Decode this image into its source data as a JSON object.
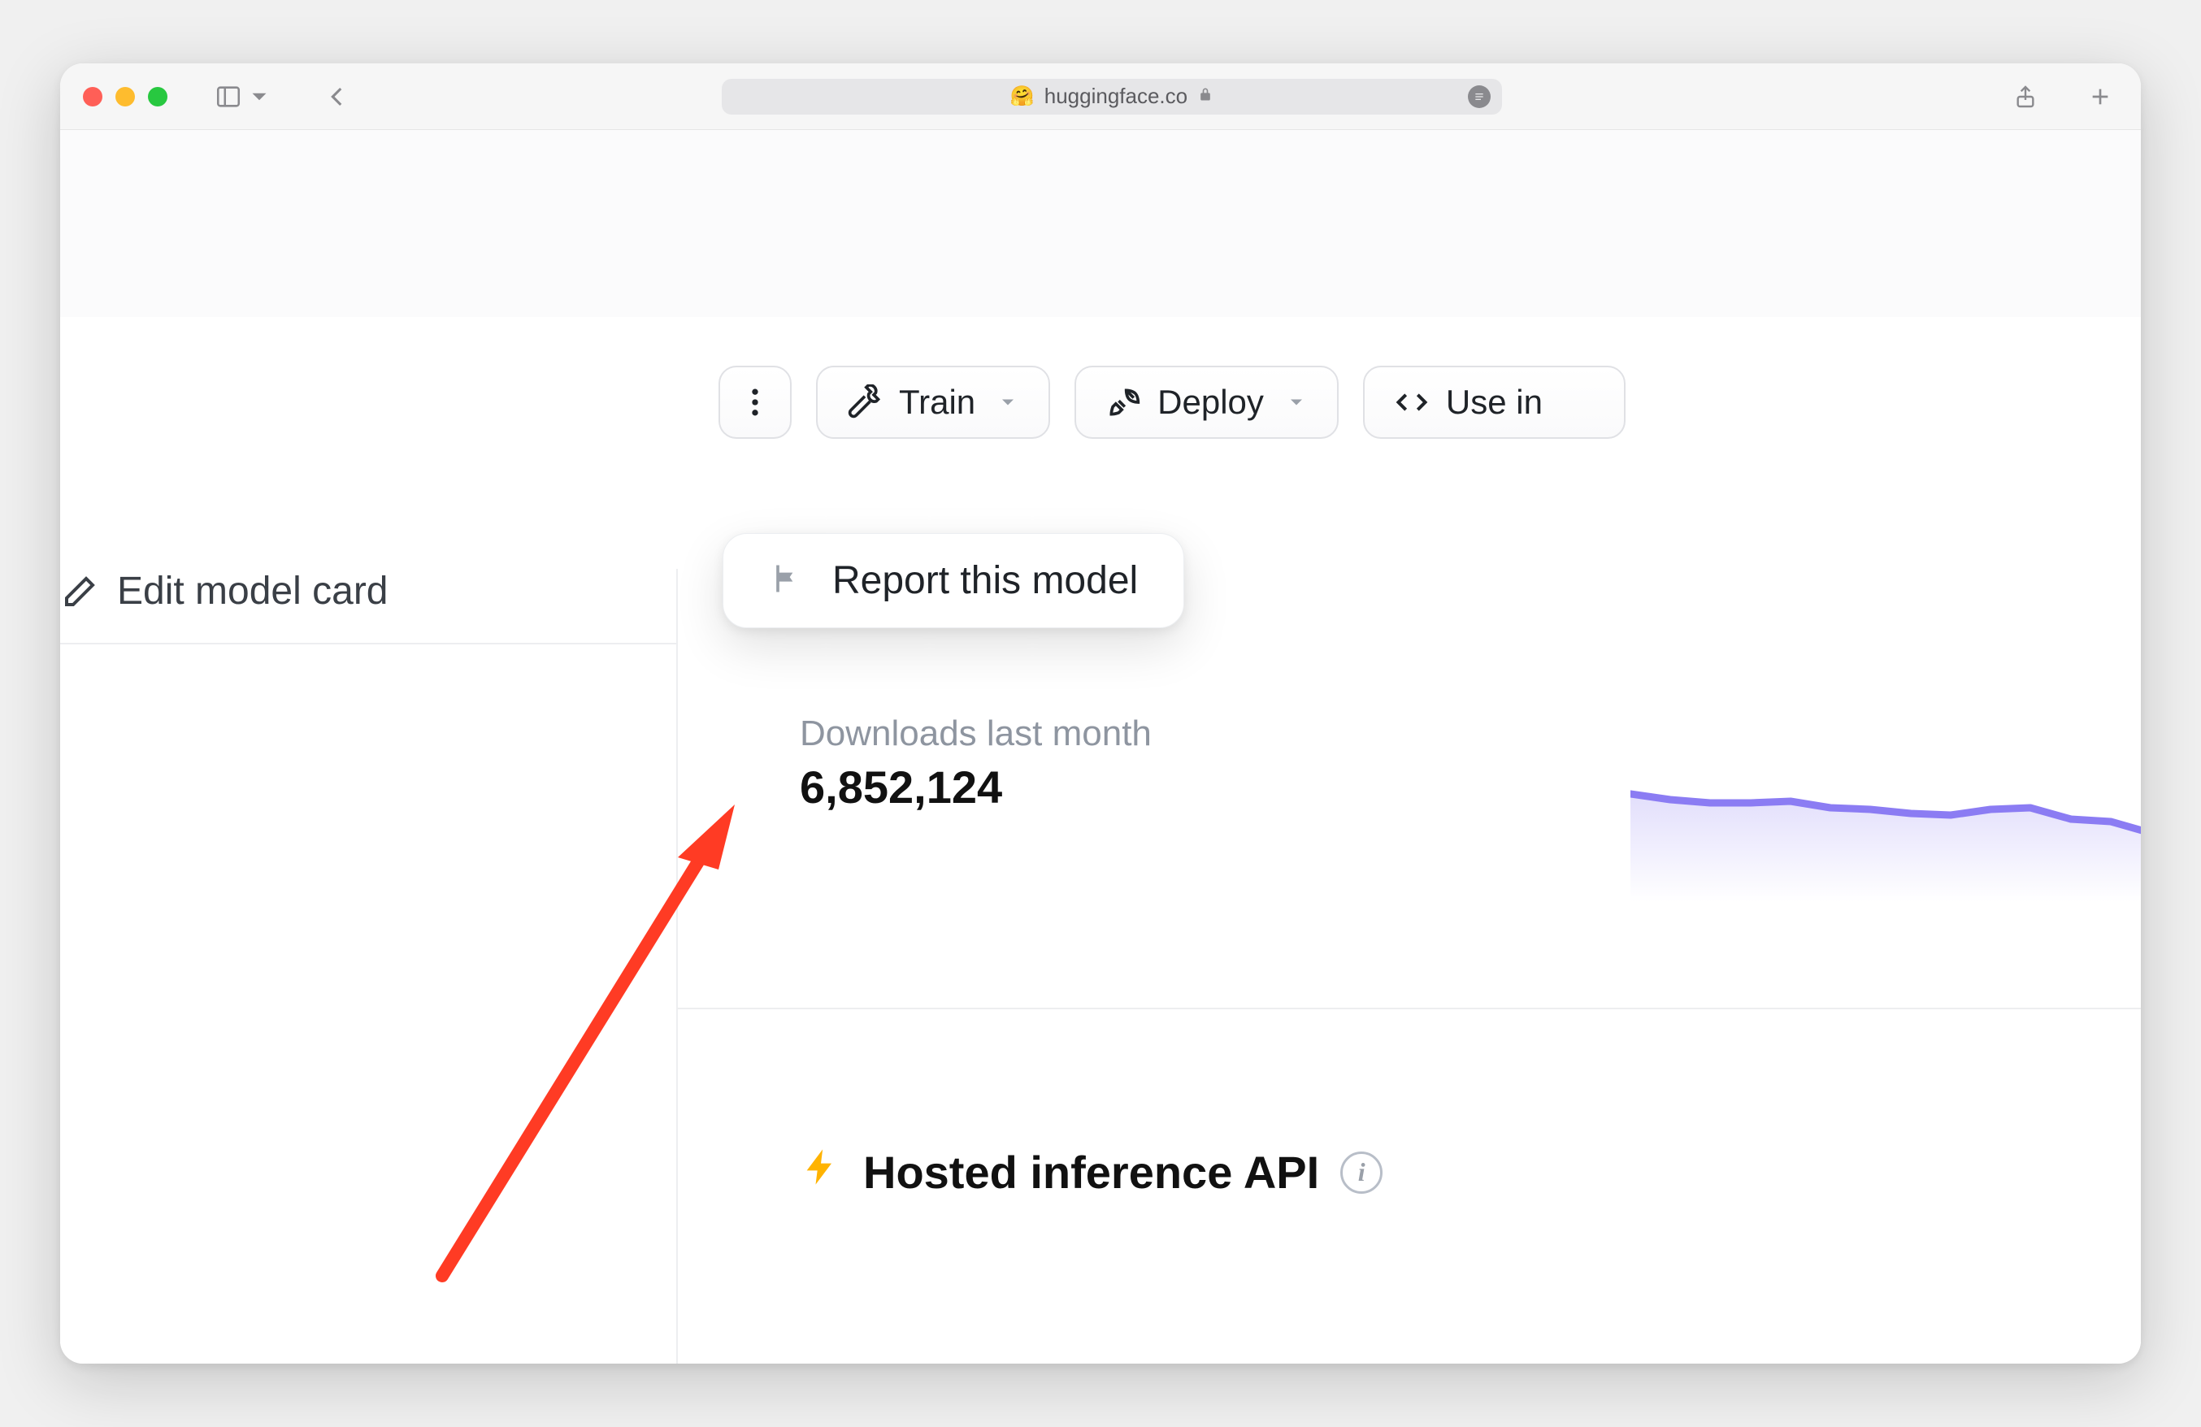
{
  "browser": {
    "url_display": "huggingface.co",
    "favicon": "🤗"
  },
  "actions": {
    "train_label": "Train",
    "deploy_label": "Deploy",
    "use_in_label": "Use in"
  },
  "popover": {
    "report_label": "Report this model"
  },
  "left": {
    "edit_label": "Edit model card"
  },
  "downloads": {
    "caption": "Downloads last month",
    "value": "6,852,124"
  },
  "hosted": {
    "title": "Hosted inference API"
  },
  "chart_data": {
    "type": "line",
    "title": "Downloads last month",
    "x": [
      0,
      1,
      2,
      3,
      4,
      5,
      6,
      7,
      8,
      9,
      10,
      11,
      12,
      13
    ],
    "values": [
      78,
      74,
      72,
      72,
      73,
      68,
      67,
      64,
      63,
      67,
      68,
      60,
      58,
      50
    ],
    "ylim": [
      0,
      100
    ],
    "note": "relative values estimated from sparkline pixels; absolute scale not shown in UI"
  }
}
